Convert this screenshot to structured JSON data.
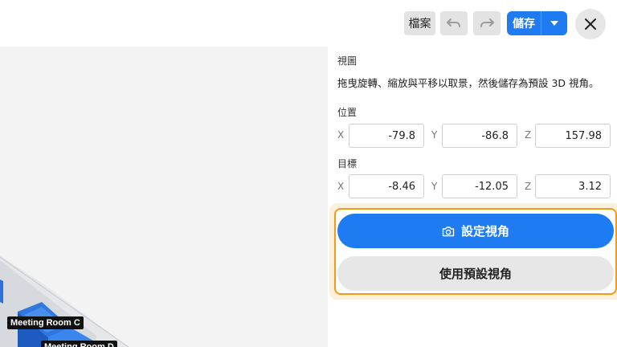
{
  "toolbar": {
    "file_label": "檔案",
    "save_label": "儲存"
  },
  "viewport": {
    "rooms": [
      "Meeting Room C",
      "Meeting Room D"
    ]
  },
  "panel": {
    "view_title": "視圖",
    "description": "拖曳旋轉、縮放與平移以取景，然後儲存為預設 3D 視角。",
    "position": {
      "title": "位置",
      "x_label": "X",
      "x": "-79.8",
      "y_label": "Y",
      "y": "-86.8",
      "z_label": "Z",
      "z": "157.98"
    },
    "target": {
      "title": "目標",
      "x_label": "X",
      "x": "-8.46",
      "y_label": "Y",
      "y": "-12.05",
      "z_label": "Z",
      "z": "3.12"
    },
    "set_view_label": "設定視角",
    "use_default_label": "使用預設視角"
  },
  "colors": {
    "accent": "#1f7bf2",
    "highlight": "#f39a1a"
  }
}
